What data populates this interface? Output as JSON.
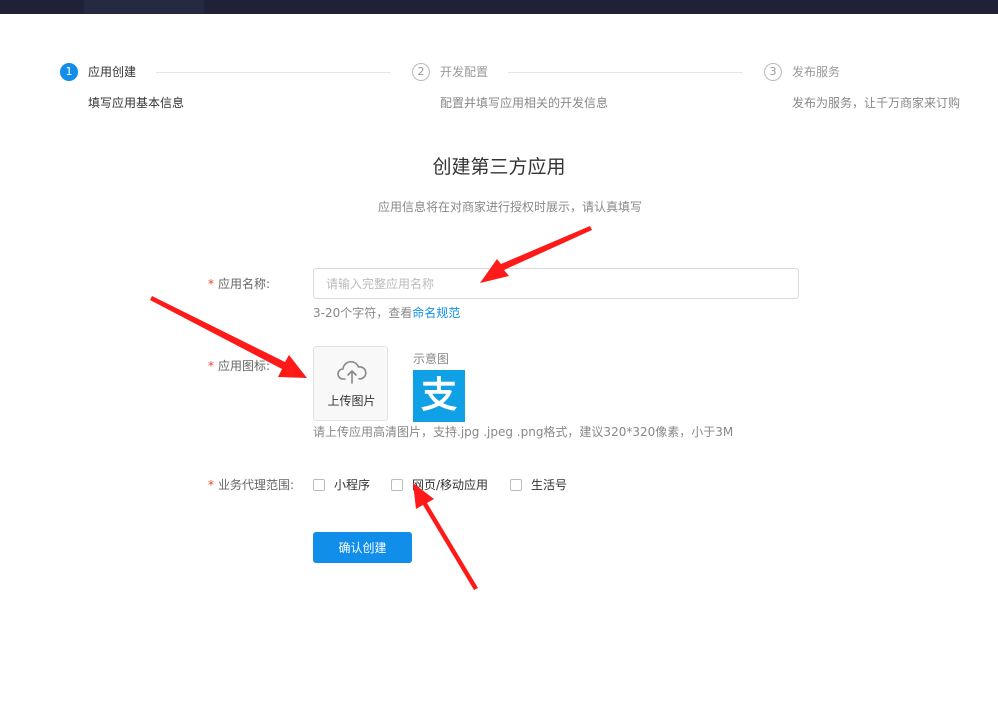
{
  "steps": [
    {
      "num": "1",
      "title": "应用创建",
      "desc": "填写应用基本信息",
      "status": "active"
    },
    {
      "num": "2",
      "title": "开发配置",
      "desc": "配置并填写应用相关的开发信息",
      "status": "wait"
    },
    {
      "num": "3",
      "title": "发布服务",
      "desc": "发布为服务，让千万商家来订购",
      "status": "wait"
    }
  ],
  "page": {
    "title": "创建第三方应用",
    "subtitle": "应用信息将在对商家进行授权时展示，请认真填写"
  },
  "form": {
    "required_mark": "*",
    "name_label": "应用名称:",
    "name_placeholder": "请输入完整应用名称",
    "name_value": "",
    "name_hint_prefix": "3-20个字符，查看",
    "name_hint_link": "命名规范",
    "icon_label": "应用图标:",
    "upload_text": "上传图片",
    "sample_label": "示意图",
    "sample_icon_glyph": "支",
    "icon_hint": "请上传应用高清图片，支持.jpg .jpeg .png格式，建议320*320像素，小于3M",
    "scope_label": "业务代理范围:",
    "scope_options": [
      "小程序",
      "网页/移动应用",
      "生活号"
    ],
    "submit_label": "确认创建"
  },
  "colors": {
    "primary": "#108ee9",
    "required": "#f04134",
    "annotation_arrow": "#ff1a1a",
    "topbar": "#1f2236",
    "sample_icon_bg": "#0fa0e6"
  }
}
